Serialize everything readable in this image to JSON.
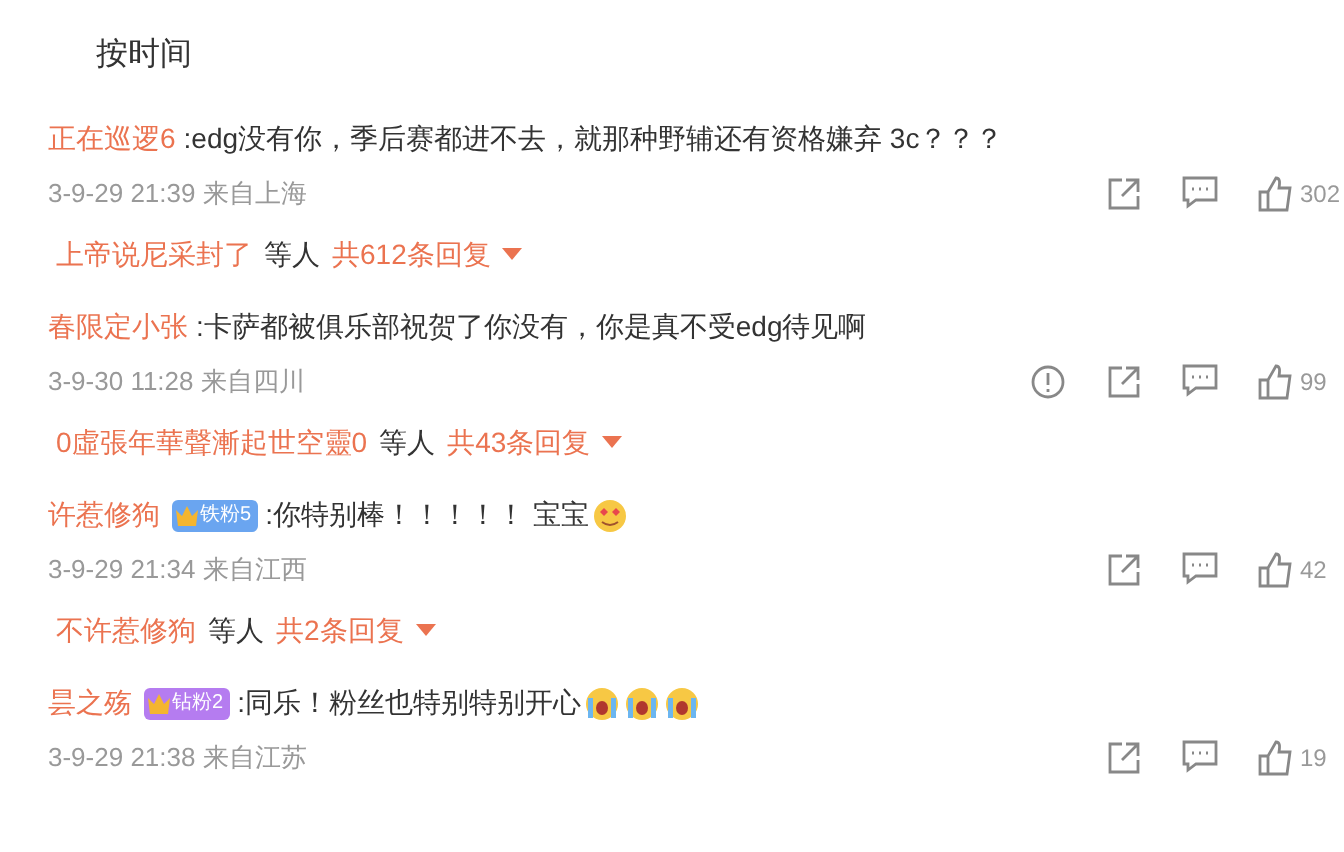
{
  "sort_label": "按时间",
  "comments": [
    {
      "author": "正在巡逻6",
      "text": ":edg没有你，季后赛都进不去，就那种野辅还有资格嫌弃 3c？？？",
      "time": "3-9-29 21:39 来自上海",
      "report": false,
      "likes": "302",
      "replies": {
        "user": "上帝说尼采封了",
        "suffix": "等人",
        "count": "共612条回复"
      }
    },
    {
      "author": "春限定小张",
      "text": ":卡萨都被俱乐部祝贺了你没有，你是真不受edg待见啊",
      "time": "3-9-30 11:28 来自四川",
      "report": true,
      "likes": "99",
      "replies": {
        "user": "0虛張年華聲漸起世空靈0",
        "suffix": "等人",
        "count": "共43条回复"
      }
    },
    {
      "author": "许惹修狗",
      "badge": {
        "label": "铁粉5",
        "color": "#6aa5f0"
      },
      "text": ":你特别棒！！！！！ 宝宝",
      "emojis": [
        {
          "kind": "heart"
        }
      ],
      "time": "3-9-29 21:34 来自江西",
      "report": false,
      "likes": "42",
      "replies": {
        "user": "不许惹修狗",
        "suffix": "等人",
        "count": "共2条回复"
      }
    },
    {
      "author": "昙之殇",
      "badge": {
        "label": "钻粉2",
        "color": "#b57cf0"
      },
      "text": ":同乐！粉丝也特别特别开心",
      "emojis": [
        {
          "kind": "cry"
        },
        {
          "kind": "cry"
        },
        {
          "kind": "cry"
        }
      ],
      "time": "3-9-29 21:38 来自江苏",
      "report": false,
      "likes": "19"
    }
  ]
}
